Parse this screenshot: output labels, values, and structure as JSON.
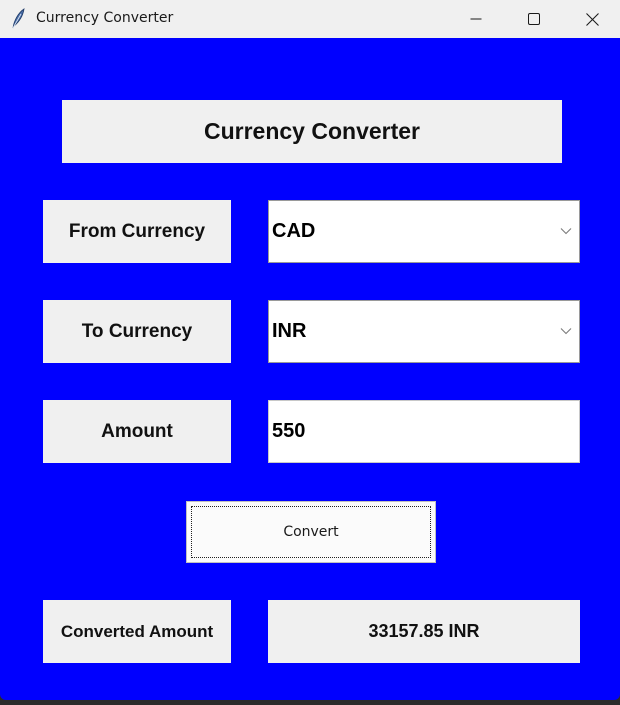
{
  "window": {
    "title": "Currency Converter",
    "icon": "feather-icon"
  },
  "app": {
    "header": "Currency Converter",
    "from_label": "From Currency",
    "from_value": "CAD",
    "to_label": "To Currency",
    "to_value": "INR",
    "amount_label": "Amount",
    "amount_value": "550",
    "convert_label": "Convert",
    "converted_label": "Converted Amount",
    "converted_value": "33157.85 INR"
  },
  "colors": {
    "background": "#0000ff",
    "panel": "#f0f0f0",
    "field": "#ffffff"
  }
}
